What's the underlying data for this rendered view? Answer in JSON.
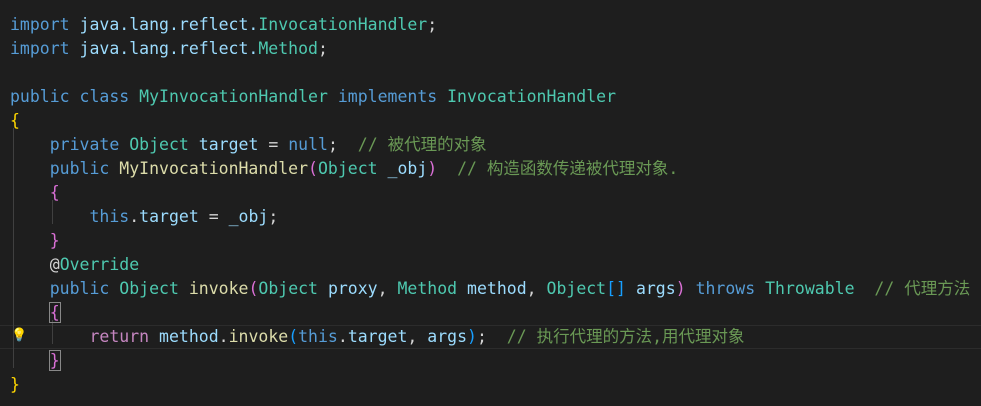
{
  "code": {
    "line1": {
      "kw": "import",
      "path": "java.lang.reflect.",
      "cls": "InvocationHandler",
      "semi": ";"
    },
    "line2": {
      "kw": "import",
      "path": "java.lang.reflect.",
      "cls": "Method",
      "semi": ";"
    },
    "line4": {
      "kw1": "public",
      "kw2": "class",
      "cls": "MyInvocationHandler",
      "kw3": "implements",
      "iface": "InvocationHandler"
    },
    "line5": {
      "brace": "{"
    },
    "line6": {
      "kw": "private",
      "type": "Object",
      "var": "target",
      "eq": " = ",
      "null": "null",
      "semi": ";",
      "comment": "// 被代理的对象"
    },
    "line7": {
      "kw": "public",
      "fn": "MyInvocationHandler",
      "open": "(",
      "type": "Object",
      "param": "_obj",
      "close": ")",
      "comment": "// 构造函数传递被代理对象."
    },
    "line8": {
      "brace": "{"
    },
    "line9": {
      "this": "this",
      "dot": ".",
      "var": "target",
      "eq": " = ",
      "val": "_obj",
      "semi": ";"
    },
    "line10": {
      "brace": "}"
    },
    "line11": {
      "at": "@",
      "ann": "Override"
    },
    "line12": {
      "kw": "public",
      "type": "Object",
      "fn": "invoke",
      "open": "(",
      "t1": "Object",
      "p1": "proxy",
      "c1": ", ",
      "t2": "Method",
      "p2": "method",
      "c2": ", ",
      "t3": "Object",
      "arr": "[]",
      "p3": "args",
      "close": ")",
      "kw2": "throws",
      "ex": "Throwable",
      "comment": "// 代理方法"
    },
    "line13": {
      "brace": "{"
    },
    "line14": {
      "kw": "return",
      "obj": "method",
      "dot": ".",
      "fn": "invoke",
      "open": "(",
      "this": "this",
      "dot2": ".",
      "var": "target",
      "comma": ", ",
      "arg": "args",
      "close": ")",
      "semi": ";",
      "comment": "// 执行代理的方法,用代理对象"
    },
    "line15": {
      "brace": "}"
    },
    "line16": {
      "brace": "}"
    }
  },
  "colors": {
    "background": "#1e1e1e",
    "keyword": "#569cd6",
    "type": "#4ec9b0",
    "variable": "#9cdcfe",
    "function": "#dcdcaa",
    "comment": "#6a9955",
    "control": "#c586c0"
  },
  "icons": {
    "lightbulb": "lightbulb-icon"
  }
}
